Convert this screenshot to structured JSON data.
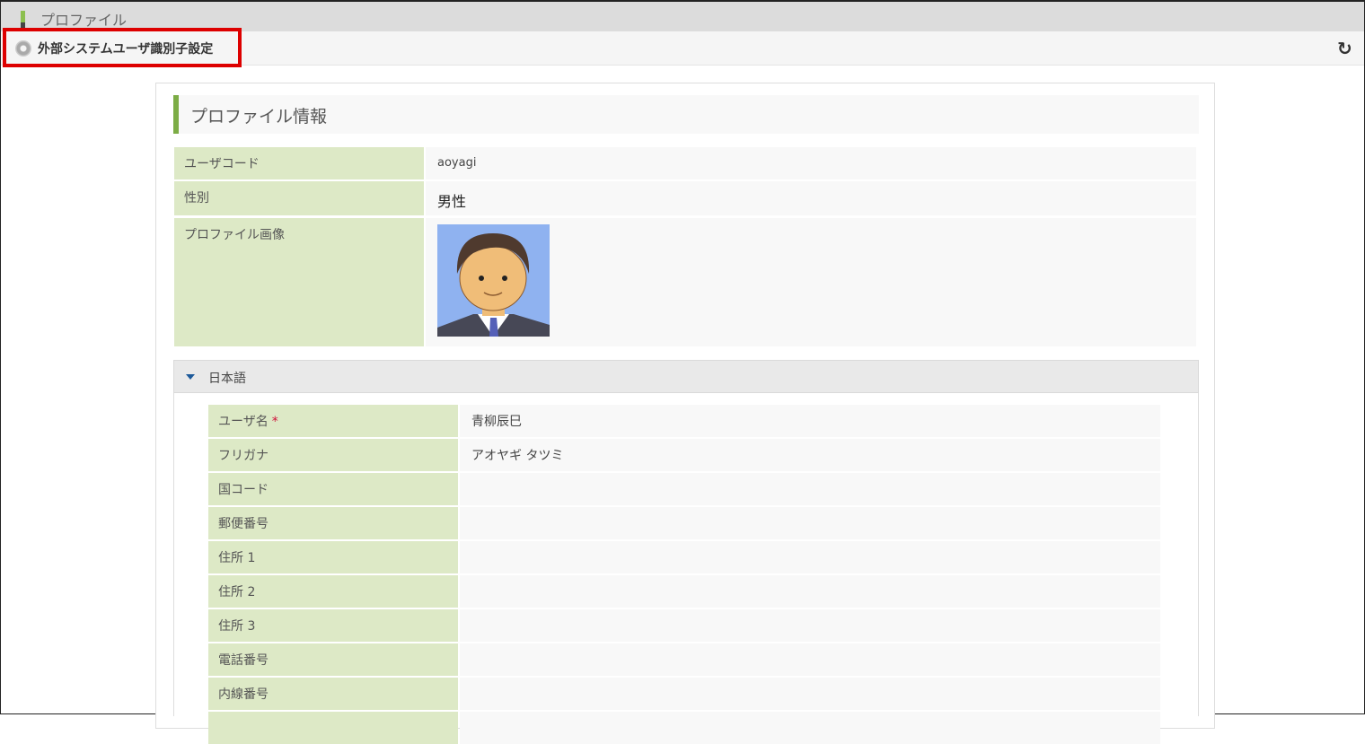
{
  "topbar": {
    "title": "プロファイル"
  },
  "subbar": {
    "title": "外部システムユーザ識別子設定"
  },
  "panel": {
    "title": "プロファイル情報",
    "fields": [
      {
        "label": "ユーザコード",
        "value": "aoyagi"
      },
      {
        "label": "性別",
        "value": "男性"
      },
      {
        "label": "プロファイル画像",
        "value": ""
      }
    ],
    "section": {
      "title": "日本語",
      "fields": [
        {
          "label": "ユーザ名",
          "required": "*",
          "value": "青柳辰巳"
        },
        {
          "label": "フリガナ",
          "value": "アオヤギ タツミ"
        },
        {
          "label": "国コード",
          "value": ""
        },
        {
          "label": "郵便番号",
          "value": ""
        },
        {
          "label": "住所 1",
          "value": ""
        },
        {
          "label": "住所 2",
          "value": ""
        },
        {
          "label": "住所 3",
          "value": ""
        },
        {
          "label": "電話番号",
          "value": ""
        },
        {
          "label": "内線番号",
          "value": ""
        },
        {
          "label": "",
          "value": ""
        }
      ]
    }
  }
}
